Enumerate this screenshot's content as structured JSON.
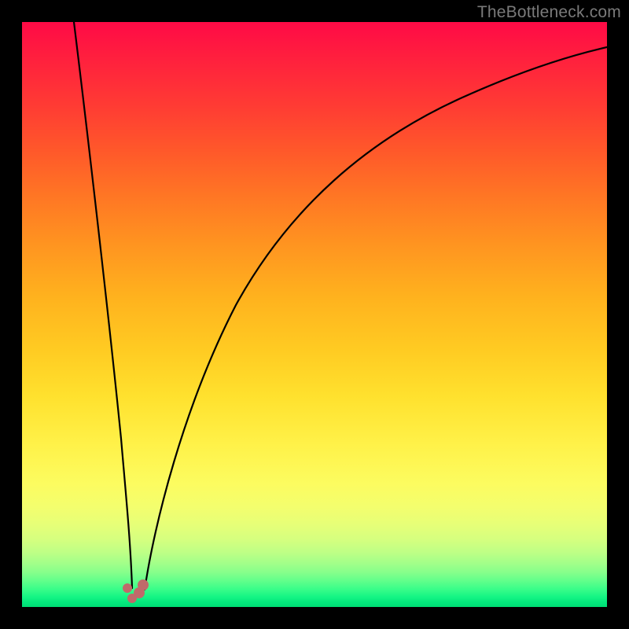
{
  "watermark": "TheBottleneck.com",
  "chart_data": {
    "type": "line",
    "title": "",
    "xlabel": "",
    "ylabel": "",
    "xlim": [
      0,
      100
    ],
    "ylim": [
      0,
      100
    ],
    "series": [
      {
        "name": "left-branch",
        "x": [
          9,
          10,
          12,
          14,
          16,
          17,
          17.8,
          18.3
        ],
        "values": [
          100,
          87,
          64,
          42,
          22,
          12,
          5,
          2
        ]
      },
      {
        "name": "right-branch",
        "x": [
          20.5,
          22,
          24,
          27,
          31,
          36,
          42,
          50,
          60,
          72,
          86,
          100
        ],
        "values": [
          2,
          8,
          17,
          29,
          41,
          52,
          62,
          71,
          79,
          86,
          92,
          96
        ]
      }
    ],
    "markers": {
      "name": "highlight-points",
      "color": "#c06a6a",
      "x": [
        17.9,
        18.9,
        20.0,
        20.6
      ],
      "values": [
        3.2,
        1.5,
        2.4,
        3.8
      ]
    },
    "gradient_stops": [
      {
        "pct": 0,
        "color": "#ff0a46"
      },
      {
        "pct": 50,
        "color": "#ffc020"
      },
      {
        "pct": 80,
        "color": "#fcfc60"
      },
      {
        "pct": 100,
        "color": "#00dd74"
      }
    ]
  }
}
